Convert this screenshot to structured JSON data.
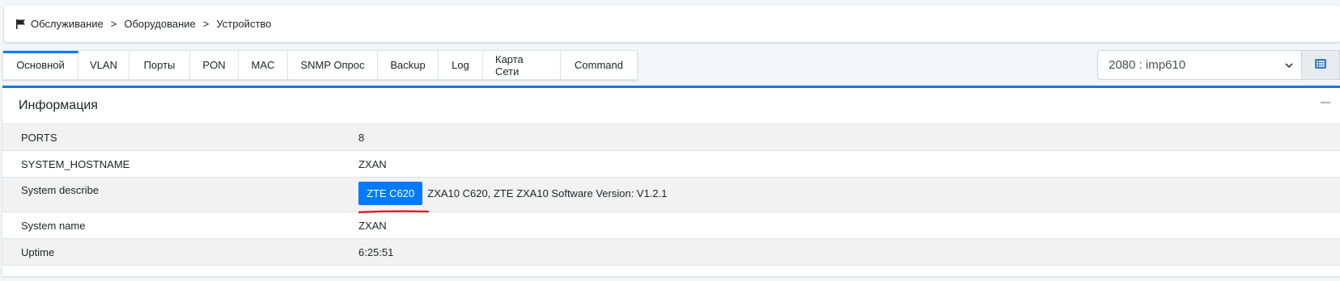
{
  "breadcrumb": {
    "items": [
      "Обслуживание",
      "Оборудование",
      "Устройство"
    ],
    "separator": ">"
  },
  "tabs": [
    {
      "label": "Основной",
      "active": true
    },
    {
      "label": "VLAN"
    },
    {
      "label": "Порты"
    },
    {
      "label": "PON"
    },
    {
      "label": "MAC"
    },
    {
      "label": "SNMP Опрос"
    },
    {
      "label": "Backup"
    },
    {
      "label": "Log"
    },
    {
      "label": "Карта Сети"
    },
    {
      "label": "Command"
    }
  ],
  "device_select": {
    "value": "2080 : imp610"
  },
  "info_card": {
    "title": "Информация",
    "rows": [
      {
        "key": "PORTS",
        "value": "8"
      },
      {
        "key": "SYSTEM_HOSTNAME",
        "value": "ZXAN"
      },
      {
        "key": "System describe",
        "badge": "ZTE C620",
        "value": "ZXA10 C620, ZTE ZXA10 Software Version: V1.2.1"
      },
      {
        "key": "System name",
        "value": "ZXAN"
      },
      {
        "key": "Uptime",
        "value": "6:25:51"
      }
    ]
  },
  "colors": {
    "accent": "#007bff",
    "annotation": "#d9232e"
  },
  "icons": {
    "breadcrumb": "flag-icon",
    "select": "chevron-down-icon",
    "list_button": "list-icon",
    "collapse": "minus-icon"
  }
}
